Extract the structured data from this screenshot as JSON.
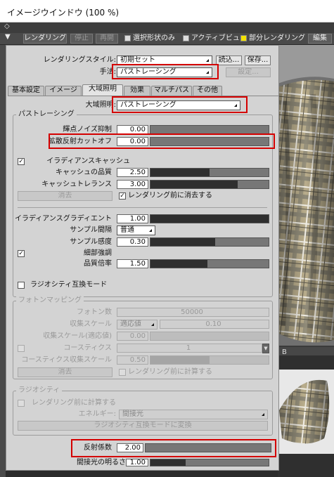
{
  "window": {
    "title": "イメージウインドウ (100 %)",
    "arrow": "◇",
    "collapse": "▼"
  },
  "toolbar": {
    "render": "レンダリング",
    "stop": "停止",
    "resume": "再開",
    "show_selection": "選択形状のみ",
    "active_view": "アクティブビュー",
    "partial_render": "部分レンダリング",
    "edit": "編集"
  },
  "render": {
    "style_label": "レンダリングスタイル:",
    "style_value": "初期セット",
    "load": "読込...",
    "save": "保存...",
    "method_label": "手法:",
    "method_value": "パストレーシング",
    "settings": "設定..."
  },
  "tabs": [
    "基本設定",
    "イメージ",
    "大域照明",
    "効果",
    "マルチパス",
    "その他"
  ],
  "gi": {
    "label": "大域照明:",
    "value": "パストレーシング"
  },
  "pathtracing": {
    "title": "パストレーシング",
    "bright_noise_label": "輝点ノイズ抑制",
    "bright_noise_value": "0.00",
    "diffuse_cutoff_label": "拡散反射カットオフ",
    "diffuse_cutoff_value": "0.00",
    "irradiance_cache": "イラディアンスキャッシュ",
    "cache_quality_label": "キャッシュの品質",
    "cache_quality_value": "2.50",
    "cache_tolerance_label": "キャッシュトレランス",
    "cache_tolerance_value": "3.00",
    "clear": "消去",
    "clear_before_render": "レンダリング前に消去する",
    "irr_gradient_label": "イラディアンスグラディエント",
    "irr_gradient_value": "1.00",
    "sample_interval_label": "サンプル間隔",
    "sample_interval_value": "普通",
    "sample_sensitivity_label": "サンプル感度",
    "sample_sensitivity_value": "0.30",
    "detail_enhance": "細部強調",
    "quality_mult_label": "品質倍率",
    "quality_mult_value": "1.50",
    "radiosity_compat": "ラジオシティ互換モード"
  },
  "photon": {
    "title": "フォトンマッピング",
    "photons_label": "フォトン数",
    "photons_value": "50000",
    "collect_scale_label": "収集スケール",
    "collect_scale_mode": "適応値",
    "collect_scale_value": "0.10",
    "collect_scale_adaptive_label": "収集スケール(適応値)",
    "collect_scale_adaptive_value": "0.00",
    "caustics": "コースティクス",
    "caustics_value": "1",
    "caustics_scale_label": "コースティクス収集スケール",
    "caustics_scale_value": "0.50",
    "clear": "消去",
    "compute_before_render": "レンダリング前に計算する"
  },
  "radiosity": {
    "title": "ラジオシティ",
    "compute_before_render": "レンダリング前に計算する",
    "energy_label": "エネルギー:",
    "energy_value": "間接光",
    "convert": "ラジオシティ互換モードに変換"
  },
  "bottom": {
    "reflection_label": "反射係数",
    "reflection_value": "2.00",
    "indirect_label": "間接光の明るさ",
    "indirect_value": "1.00"
  },
  "viewport": {
    "fragment": "B"
  },
  "colors": {
    "highlight": "#d40000",
    "partial_render_check": "#f3e200"
  },
  "sliders": {
    "bright_noise": 0.0,
    "diffuse_cutoff": 0.0,
    "cache_quality": 0.5,
    "cache_tolerance": 0.74,
    "irr_gradient": 1.0,
    "sample_sensitivity": 0.55,
    "quality_mult": 0.48,
    "collect_scale_adaptive": 0.0,
    "caustics_scale": 0.5,
    "reflection": 0.0,
    "indirect": 0.3
  }
}
